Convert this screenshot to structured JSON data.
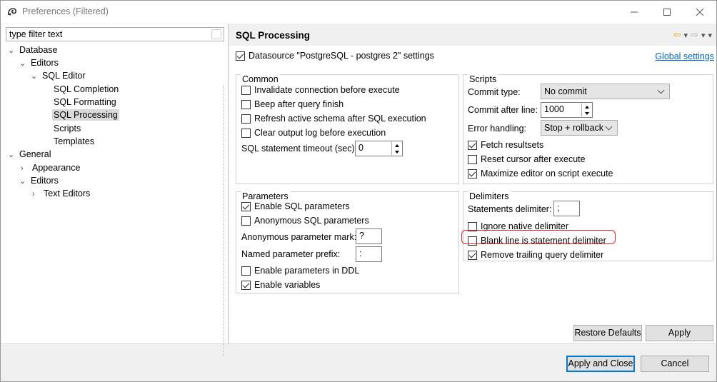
{
  "window": {
    "title": "Preferences (Filtered)"
  },
  "filter": {
    "placeholder": "type filter text"
  },
  "tree": [
    {
      "label": "Database",
      "twisty": "v"
    },
    {
      "label": "Editors",
      "twisty": "v"
    },
    {
      "label": "SQL Editor",
      "twisty": "v"
    },
    {
      "label": "SQL Completion",
      "twisty": ""
    },
    {
      "label": "SQL Formatting",
      "twisty": ""
    },
    {
      "label": "SQL Processing",
      "twisty": ""
    },
    {
      "label": "Scripts",
      "twisty": ""
    },
    {
      "label": "Templates",
      "twisty": ""
    },
    {
      "label": "General",
      "twisty": "v"
    },
    {
      "label": "Appearance",
      "twisty": ">"
    },
    {
      "label": "Editors",
      "twisty": "v"
    },
    {
      "label": "Text Editors",
      "twisty": ">"
    }
  ],
  "page": {
    "title": "SQL Processing",
    "datasource_label": "Datasource \"PostgreSQL - postgres 2\" settings",
    "datasource_checked": true,
    "global_link": "Global settings"
  },
  "common": {
    "title": "Common",
    "items": [
      {
        "label": "Invalidate connection before execute",
        "checked": false
      },
      {
        "label": "Beep after query finish",
        "checked": false
      },
      {
        "label": "Refresh active schema after SQL execution",
        "checked": false
      },
      {
        "label": "Clear output log before execution",
        "checked": false
      }
    ],
    "timeout_label": "SQL statement timeout (sec):",
    "timeout_value": "0"
  },
  "scripts": {
    "title": "Scripts",
    "commit_type_label": "Commit type:",
    "commit_type_value": "No commit",
    "commit_after_label": "Commit after line:",
    "commit_after_value": "1000",
    "error_label": "Error handling:",
    "error_value": "Stop + rollback",
    "items": [
      {
        "label": "Fetch resultsets",
        "checked": true
      },
      {
        "label": "Reset cursor after execute",
        "checked": false
      },
      {
        "label": "Maximize editor on script execute",
        "checked": true
      }
    ]
  },
  "parameters": {
    "title": "Parameters",
    "enable_sql": {
      "label": "Enable SQL parameters",
      "checked": true
    },
    "anonymous": {
      "label": "Anonymous SQL parameters",
      "checked": false
    },
    "anon_mark_label": "Anonymous parameter mark:",
    "anon_mark_value": "?",
    "named_prefix_label": "Named parameter prefix:",
    "named_prefix_value": ":",
    "enable_ddl": {
      "label": "Enable parameters in DDL",
      "checked": false
    },
    "enable_vars": {
      "label": "Enable variables",
      "checked": true
    }
  },
  "delimiters": {
    "title": "Delimiters",
    "statements_label": "Statements delimiter:",
    "statements_value": ";",
    "items": [
      {
        "label": "Ignore native delimiter",
        "checked": false
      },
      {
        "label": "Blank line is statement delimiter",
        "checked": false
      },
      {
        "label": "Remove trailing query delimiter",
        "checked": true
      }
    ]
  },
  "buttons": {
    "restore": "Restore Defaults",
    "apply": "Apply",
    "apply_close": "Apply and Close",
    "cancel": "Cancel"
  },
  "colors": {
    "highlight": "#e0262b",
    "link": "#0066cc",
    "selected": "#d9d9d9"
  }
}
